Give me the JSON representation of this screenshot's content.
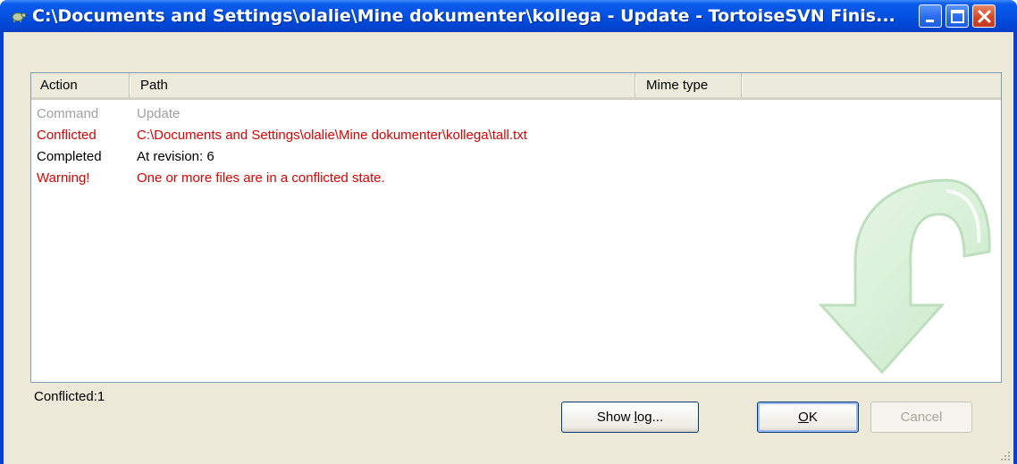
{
  "window": {
    "title": "C:\\Documents and Settings\\olalie\\Mine dokumenter\\kollega - Update - TortoiseSVN Finis..."
  },
  "list": {
    "columns": [
      "Action",
      "Path",
      "Mime type"
    ],
    "rows": [
      {
        "action": "Command",
        "path": "Update",
        "color": "#a0a0a0"
      },
      {
        "action": "Conflicted",
        "path": "C:\\Documents and Settings\\olalie\\Mine dokumenter\\kollega\\tall.txt",
        "color": "#e00000"
      },
      {
        "action": "Completed",
        "path": "At revision: 6",
        "color": "#000000"
      },
      {
        "action": "Warning!",
        "path": "One or more files are in a conflicted state.",
        "color": "#e00000"
      }
    ]
  },
  "status": {
    "text": "Conflicted:1"
  },
  "buttons": {
    "show_log": "Show log...",
    "ok": "OK",
    "cancel": "Cancel"
  },
  "colors": {
    "titlebar": "#0552e2",
    "conflict": "#e00000",
    "command": "#a0a0a0",
    "dialog_bg": "#ece9d8"
  },
  "icons": {
    "app": "tortoise-icon",
    "minimize": "minimize-icon",
    "maximize": "maximize-icon",
    "close": "close-icon",
    "watermark": "update-arrow-icon",
    "grip": "resize-grip-icon"
  }
}
